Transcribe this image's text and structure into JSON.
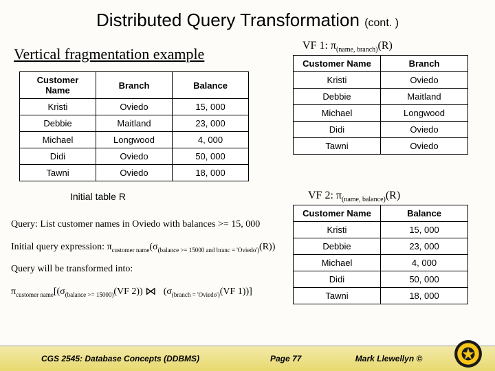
{
  "title": {
    "main": "Distributed Query Transformation",
    "cont": "(cont. )"
  },
  "section": "Vertical fragmentation example",
  "vf1_label": "VF 1: π",
  "vf1_sub": "(name, branch)",
  "vf1_tail": "(R)",
  "vf2_label": "VF 2: π",
  "vf2_sub": "(name, balance)",
  "vf2_tail": "(R)",
  "tableR": {
    "headers": [
      "Customer Name",
      "Branch",
      "Balance"
    ],
    "rows": [
      [
        "Kristi",
        "Oviedo",
        "15, 000"
      ],
      [
        "Debbie",
        "Maitland",
        "23, 000"
      ],
      [
        "Michael",
        "Longwood",
        "4, 000"
      ],
      [
        "Didi",
        "Oviedo",
        "50, 000"
      ],
      [
        "Tawni",
        "Oviedo",
        "18, 000"
      ]
    ],
    "caption": "Initial table R"
  },
  "tableVF1": {
    "headers": [
      "Customer Name",
      "Branch"
    ],
    "rows": [
      [
        "Kristi",
        "Oviedo"
      ],
      [
        "Debbie",
        "Maitland"
      ],
      [
        "Michael",
        "Longwood"
      ],
      [
        "Didi",
        "Oviedo"
      ],
      [
        "Tawni",
        "Oviedo"
      ]
    ]
  },
  "tableVF2": {
    "headers": [
      "Customer Name",
      "Balance"
    ],
    "rows": [
      [
        "Kristi",
        "15, 000"
      ],
      [
        "Debbie",
        "23, 000"
      ],
      [
        "Michael",
        "4, 000"
      ],
      [
        "Didi",
        "50, 000"
      ],
      [
        "Tawni",
        "18, 000"
      ]
    ]
  },
  "query": {
    "line1": "Query: List customer names in Oviedo with balances >= 15, 000",
    "line2_a": "Initial query expression: π",
    "line2_sub1": "customer name",
    "line2_b": "(σ",
    "line2_sub2": "(balance >= 15000 and branc = 'Oviedo')",
    "line2_c": "(R))",
    "line3": "Query will be transformed into:",
    "line4_a": "π",
    "line4_sub1": "customer name",
    "line4_b": "[(σ",
    "line4_sub2": "(balance >= 15000)",
    "line4_c": "(VF 2))",
    "line4_d": "(σ",
    "line4_sub3": "(branch = 'Oviedo')",
    "line4_e": "(VF 1))]"
  },
  "footer": {
    "course": "CGS 2545: Database Concepts (DDBMS)",
    "page": "Page 77",
    "author": "Mark Llewellyn ©"
  }
}
